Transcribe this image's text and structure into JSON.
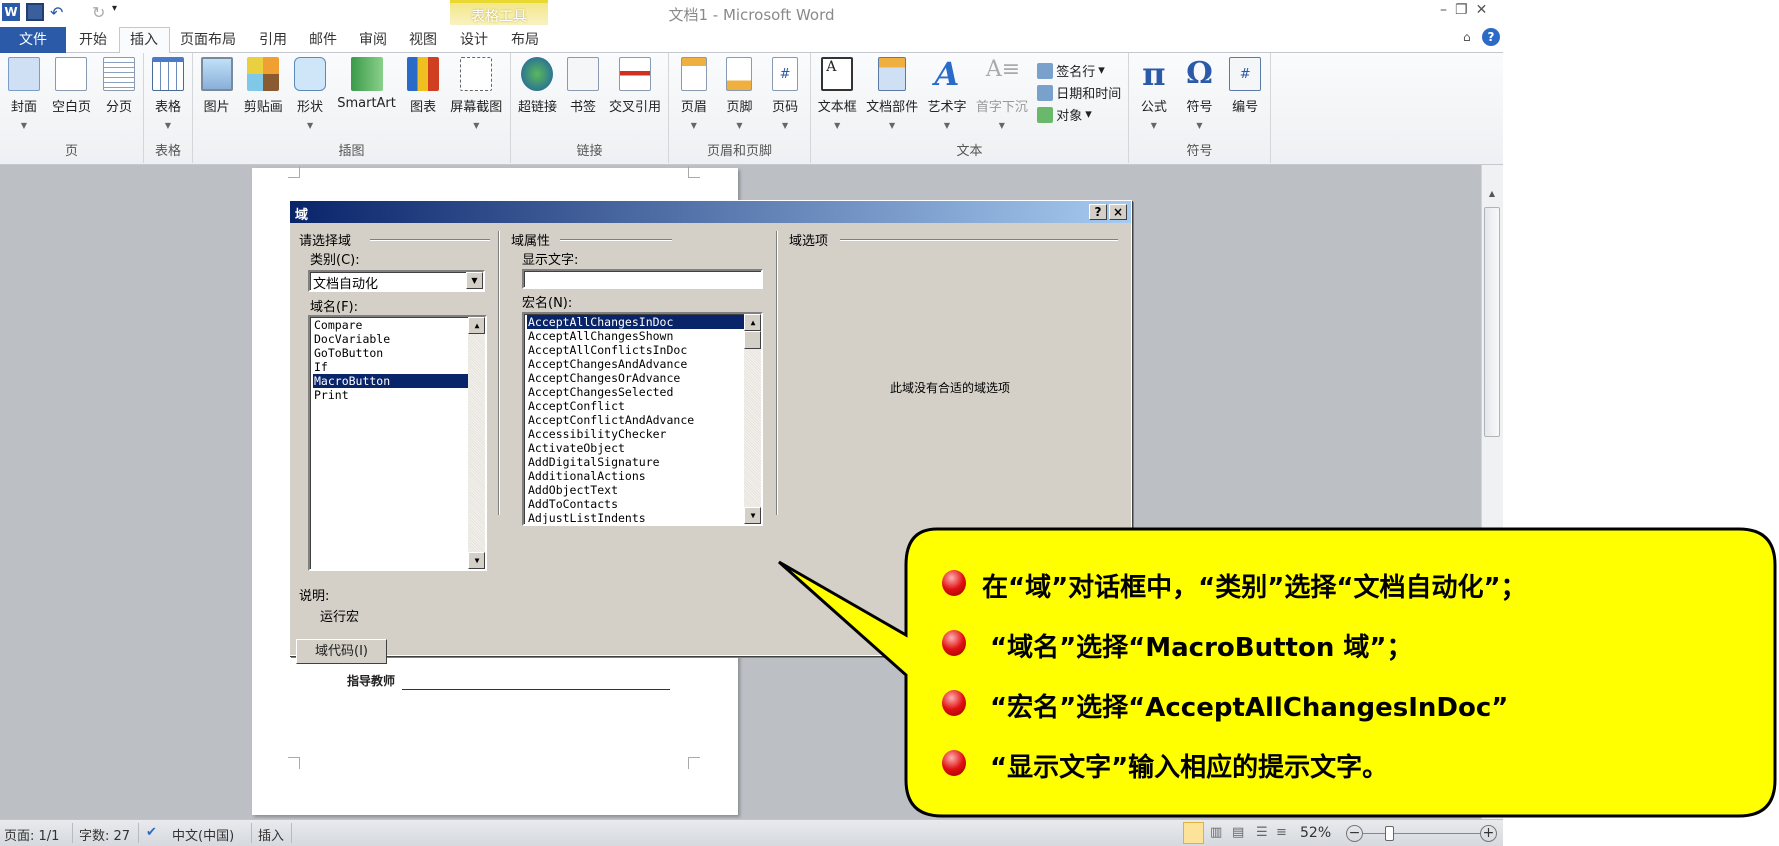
{
  "window": {
    "title": "文档1 - Microsoft Word"
  },
  "quick_access": {
    "icons": [
      "word-logo-icon",
      "save-icon",
      "undo-icon",
      "redo-icon",
      "customize-icon"
    ]
  },
  "tabs": {
    "file": "文件",
    "items": [
      "开始",
      "插入",
      "页面布局",
      "引用",
      "邮件",
      "审阅",
      "视图"
    ],
    "active": "插入",
    "contextual_group": "表格工具",
    "contextual_tabs": [
      "设计",
      "布局"
    ]
  },
  "ribbon": {
    "groups": [
      {
        "label": "页",
        "buttons": [
          {
            "label": "封面",
            "dropdown": true
          },
          {
            "label": "空白页"
          },
          {
            "label": "分页"
          }
        ]
      },
      {
        "label": "表格",
        "buttons": [
          {
            "label": "表格",
            "dropdown": true
          }
        ]
      },
      {
        "label": "插图",
        "buttons": [
          {
            "label": "图片"
          },
          {
            "label": "剪贴画"
          },
          {
            "label": "形状",
            "dropdown": true
          },
          {
            "label": "SmartArt"
          },
          {
            "label": "图表"
          },
          {
            "label": "屏幕截图",
            "dropdown": true
          }
        ]
      },
      {
        "label": "链接",
        "buttons": [
          {
            "label": "超链接"
          },
          {
            "label": "书签"
          },
          {
            "label": "交叉引用"
          }
        ]
      },
      {
        "label": "页眉和页脚",
        "buttons": [
          {
            "label": "页眉",
            "dropdown": true
          },
          {
            "label": "页脚",
            "dropdown": true
          },
          {
            "label": "页码",
            "dropdown": true
          }
        ]
      },
      {
        "label": "文本",
        "buttons": [
          {
            "label": "文本框",
            "dropdown": true
          },
          {
            "label": "文档部件",
            "dropdown": true
          },
          {
            "label": "艺术字",
            "dropdown": true
          },
          {
            "label": "首字下沉",
            "dropdown": true,
            "disabled": true
          }
        ],
        "small": [
          "签名行",
          "日期和时间",
          "对象"
        ]
      },
      {
        "label": "符号",
        "buttons": [
          {
            "label": "公式",
            "dropdown": true
          },
          {
            "label": "符号",
            "dropdown": true
          },
          {
            "label": "编号"
          }
        ]
      }
    ]
  },
  "document": {
    "label": "指导教师"
  },
  "dialog": {
    "title": "域",
    "help": "?",
    "close": "×",
    "left": {
      "group": "请选择域",
      "category_label": "类别(C):",
      "category_value": "文档自动化",
      "field_names_label": "域名(F):",
      "field_names": [
        "Compare",
        "DocVariable",
        "GoToButton",
        "If",
        "MacroButton",
        "Print"
      ],
      "selected_field": "MacroButton",
      "description_label": "说明:",
      "description": "运行宏",
      "field_codes_button": "域代码(I)"
    },
    "middle": {
      "group": "域属性",
      "display_text_label": "显示文字:",
      "display_text_value": "",
      "macro_label": "宏名(N):",
      "macros": [
        "AcceptAllChangesInDoc",
        "AcceptAllChangesShown",
        "AcceptAllConflictsInDoc",
        "AcceptChangesAndAdvance",
        "AcceptChangesOrAdvance",
        "AcceptChangesSelected",
        "AcceptConflict",
        "AcceptConflictAndAdvance",
        "AccessibilityChecker",
        "ActivateObject",
        "AddDigitalSignature",
        "AdditionalActions",
        "AddObjectText",
        "AddToContacts",
        "AdjustListIndents"
      ],
      "selected_macro": "AcceptAllChangesInDoc"
    },
    "right": {
      "group": "域选项",
      "message": "此域没有合适的域选项"
    }
  },
  "callout": {
    "color": "#ffff00",
    "lines": [
      "在“域”对话框中，“类别”选择“文档自动化”；",
      "“域名”选择“MacroButton 域”；",
      "“宏名”选择“AcceptAllChangesInDoc”",
      "“显示文字”输入相应的提示文字。"
    ]
  },
  "status": {
    "page": "页面: 1/1",
    "words": "字数: 27",
    "language": "中文(中国)",
    "mode": "插入",
    "zoom": "52%",
    "zoom_percent": 52
  }
}
